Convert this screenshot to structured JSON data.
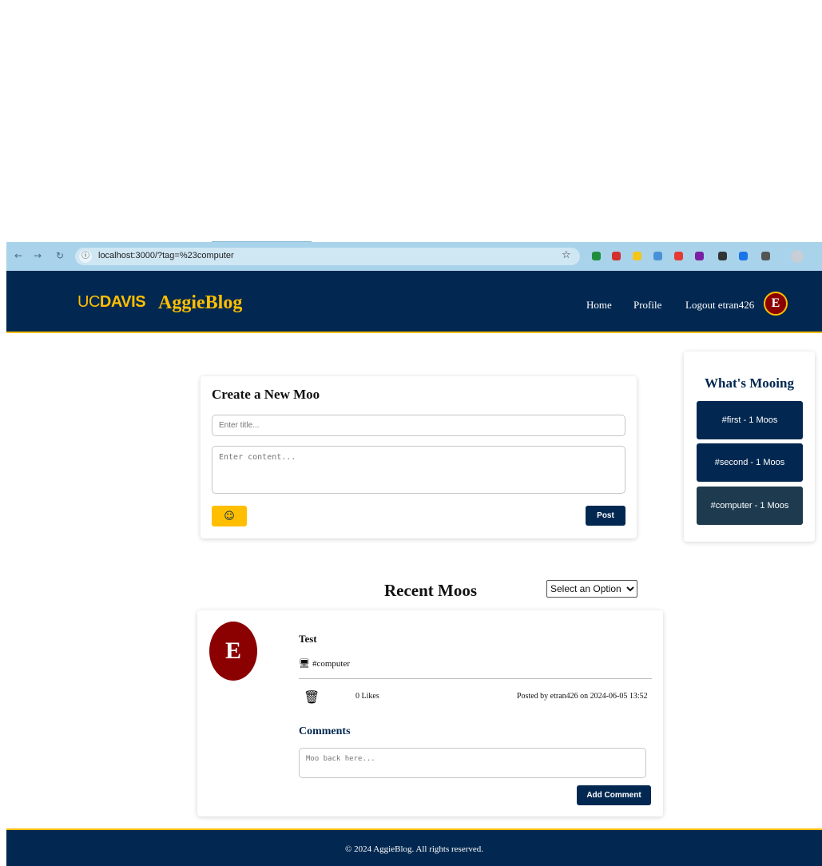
{
  "browser": {
    "url": "localhost:3000/?tag=%23computer",
    "back_icon": "arrow-left-icon",
    "forward_icon": "arrow-right-icon",
    "reload_icon": "reload-icon",
    "info_icon": "site-info-icon",
    "bookmark_icon": "star-icon",
    "extension_colors": [
      "#1e8e3e",
      "#d32f2f",
      "#f5c518",
      "#4a90d9",
      "#e53935",
      "#7b1fa2",
      "#333333",
      "#1a73e8",
      "#555555"
    ]
  },
  "header": {
    "logo_uc": "UC",
    "logo_davis": "DAVIS",
    "brand": "AggieBlog",
    "nav": {
      "home": "Home",
      "profile": "Profile",
      "logout": "Logout etran426"
    },
    "avatar_initial": "E",
    "colors": {
      "navy": "#022851",
      "gold": "#ffbf00"
    }
  },
  "create": {
    "title": "Create a New Moo",
    "title_placeholder": "Enter title...",
    "content_placeholder": "Enter content...",
    "emoji_icon": "smiley-icon",
    "emoji_glyph": "☺",
    "post_label": "Post"
  },
  "sidebar": {
    "title": "What's Mooing",
    "tags": [
      {
        "label": "#first - 1 Moos",
        "active": false
      },
      {
        "label": "#second - 1 Moos",
        "active": false
      },
      {
        "label": "#computer - 1 Moos",
        "active": true
      }
    ]
  },
  "recent": {
    "title": "Recent Moos",
    "sort_selected": "Select an Option"
  },
  "post": {
    "avatar_initial": "E",
    "title": "Test",
    "tag": "#computer",
    "tag_icon": "computer-icon",
    "delete_icon": "trash-icon",
    "likes": "0 Likes",
    "posted_by": "Posted by etran426 on 2024-06-05 13:52",
    "comments_title": "Comments",
    "comment_placeholder": "Moo back here...",
    "add_comment_label": "Add Comment"
  },
  "footer": {
    "text": "© 2024 AggieBlog. All rights reserved."
  }
}
